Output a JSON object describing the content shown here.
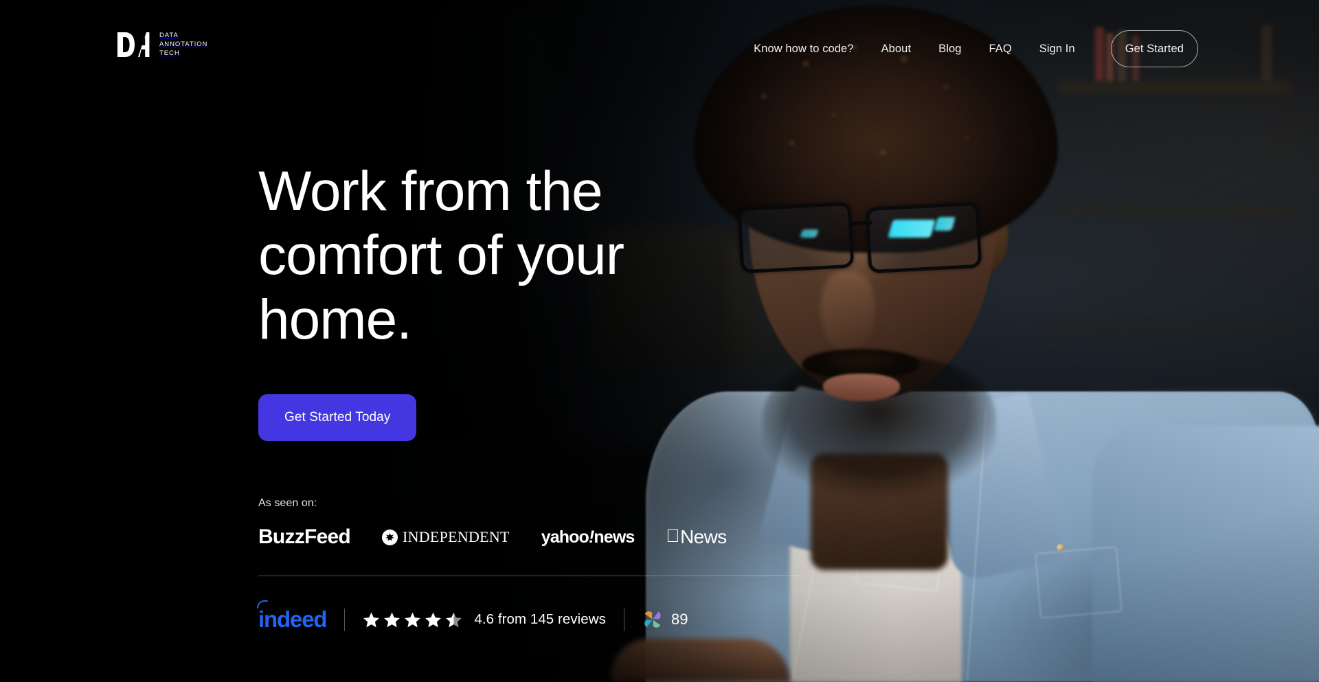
{
  "brand": {
    "mark_text": "DA",
    "line1": "DATA",
    "line2": "ANNOTATION",
    "line3": "TECH"
  },
  "nav": {
    "items": [
      {
        "label": "Know how to code?"
      },
      {
        "label": "About"
      },
      {
        "label": "Blog"
      },
      {
        "label": "FAQ"
      },
      {
        "label": "Sign In"
      }
    ],
    "cta_label": "Get Started"
  },
  "hero": {
    "headline_line1": "Work from the",
    "headline_line2": "comfort of your",
    "headline_line3": "home.",
    "cta_label": "Get Started Today",
    "cta_color": "#4437E2"
  },
  "press": {
    "label": "As seen on:",
    "logos": [
      {
        "name": "BuzzFeed",
        "text": "BuzzFeed"
      },
      {
        "name": "The Independent",
        "text": "INDEPENDENT"
      },
      {
        "name": "Yahoo News",
        "text_a": "yahoo",
        "text_b": "!",
        "text_c": "news"
      },
      {
        "name": "Apple News",
        "text": "News"
      }
    ]
  },
  "ratings": {
    "indeed_label": "indeed",
    "indeed_color": "#2164F3",
    "stars_filled": 4.5,
    "stars_total": 5,
    "review_text": "4.6 from 145 reviews",
    "rating_value": "4.6",
    "review_count": "145",
    "comparably_score": "89",
    "pinwheel_colors": {
      "top_left": "#E8943C",
      "top_right": "#9B7BE0",
      "bottom_left": "#2FA8B8",
      "bottom_right": "#74C49A"
    }
  }
}
